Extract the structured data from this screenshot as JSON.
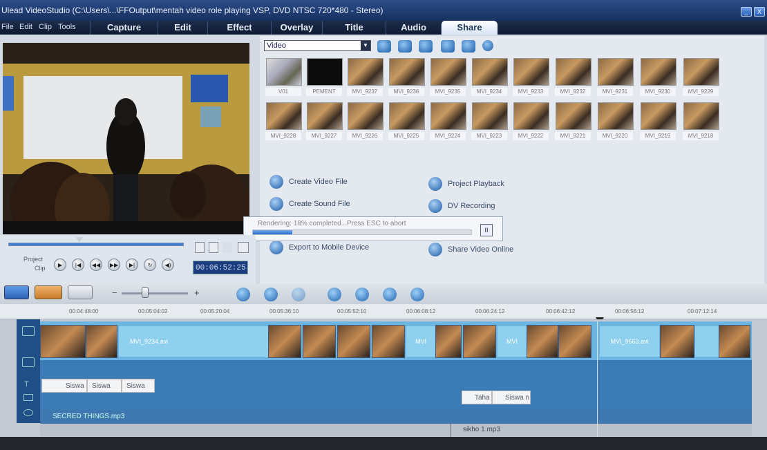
{
  "window": {
    "title": "Ulead VideoStudio (C:\\Users\\...\\FFOutput\\mentah video role playing VSP, DVD NTSC 720*480 - Stereo)",
    "minimize_label": "_",
    "close_label": "X"
  },
  "menu": {
    "file": "File",
    "edit": "Edit",
    "clip": "Clip",
    "tools": "Tools"
  },
  "steps": [
    {
      "label": "Capture"
    },
    {
      "label": "Edit"
    },
    {
      "label": "Effect"
    },
    {
      "label": "Overlay"
    },
    {
      "label": "Title"
    },
    {
      "label": "Audio"
    },
    {
      "label": "Share"
    }
  ],
  "library": {
    "dropdown_value": "Video",
    "dropdown_arrow": "▼",
    "row1": [
      "V01",
      "PEMENT",
      "MVI_9237",
      "MVI_9236",
      "MVI_9235",
      "MVI_9234",
      "MVI_9233",
      "MVI_9232",
      "MVI_9231",
      "MVI_9230",
      "MVI_9229"
    ],
    "row2": [
      "MVI_9228",
      "MVI_9227",
      "MVI_9226",
      "MVI_9225",
      "MVI_9224",
      "MVI_9223",
      "MVI_9222",
      "MVI_9221",
      "MVI_9220",
      "MVI_9219",
      "MVI_9218"
    ]
  },
  "share_options": {
    "create_video": "Create Video File",
    "create_sound": "Create Sound File",
    "export_mobile": "Export to Mobile Device",
    "project_playback": "Project Playback",
    "dv_recording": "DV Recording",
    "share_online": "Share Video Online"
  },
  "render": {
    "text": "Rendering: 18% completed...Press ESC to abort",
    "progress": 0.18,
    "pause_label": "II"
  },
  "playback": {
    "project_label": "Project",
    "clip_label": "Clip",
    "timecode": "00:06:52:25",
    "buttons": {
      "play": "▶",
      "home": "|◀",
      "prev": "◀◀",
      "next": "▶▶",
      "end": "▶|",
      "repeat": "↻",
      "volume": "◀)"
    },
    "zoom_minus": "−",
    "zoom_plus": "+"
  },
  "ruler": {
    "ticks": [
      "00:04:48:00",
      "00:05:04:02",
      "00:05:20:04",
      "00:05:36:10",
      "00:05:52:10",
      "00:06:08:12",
      "00:06:24:12",
      "00:06:42:12",
      "00:06:56:12",
      "00:07:12:14"
    ]
  },
  "timeline": {
    "transitions": [
      "MVI_9234.avi",
      "MVI",
      "MVI",
      "MVI_9663.avi"
    ],
    "titles": [
      "Siswa",
      "Siswa",
      "Siswa",
      "Taha",
      "Siswa n"
    ],
    "music": "SECRED THINGS.mp3",
    "voice": "sikho 1.mp3"
  }
}
